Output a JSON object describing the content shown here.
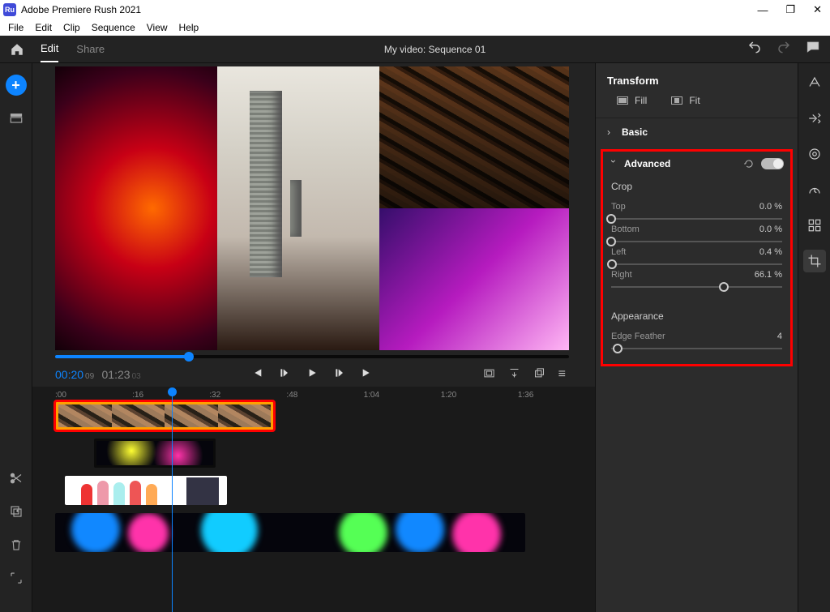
{
  "window": {
    "title": "Adobe Premiere Rush 2021",
    "app_badge": "Ru"
  },
  "menubar": [
    "File",
    "Edit",
    "Clip",
    "Sequence",
    "View",
    "Help"
  ],
  "topbar": {
    "tabs": {
      "edit": "Edit",
      "share": "Share"
    },
    "active_tab": "edit",
    "project_title": "My video: Sequence 01"
  },
  "playback": {
    "current_time": "00:20",
    "current_frame": "09",
    "duration": "01:23",
    "duration_frame": "03",
    "progress_percent": 26
  },
  "timeline_ruler": [
    ":00",
    ":16",
    ":32",
    ":48",
    "1:04",
    "1:20",
    "1:36"
  ],
  "transform_panel": {
    "title": "Transform",
    "fill": "Fill",
    "fit": "Fit",
    "basic": "Basic",
    "advanced": "Advanced",
    "crop": "Crop",
    "crop_fields": {
      "top": {
        "label": "Top",
        "value": "0.0",
        "unit": "%",
        "pos": 0
      },
      "bottom": {
        "label": "Bottom",
        "value": "0.0",
        "unit": "%",
        "pos": 0
      },
      "left": {
        "label": "Left",
        "value": "0.4",
        "unit": "%",
        "pos": 0.4
      },
      "right": {
        "label": "Right",
        "value": "66.1",
        "unit": "%",
        "pos": 66.1
      }
    },
    "appearance": "Appearance",
    "edge_feather": {
      "label": "Edge Feather",
      "value": "4",
      "pos": 4
    }
  },
  "right_tools": [
    "titles-icon",
    "transitions-icon",
    "color-icon",
    "speed-icon",
    "audio-icon",
    "crop-icon"
  ],
  "left_tools_bottom": [
    "scissors-icon",
    "duplicate-icon",
    "trash-icon",
    "expand-icon"
  ]
}
